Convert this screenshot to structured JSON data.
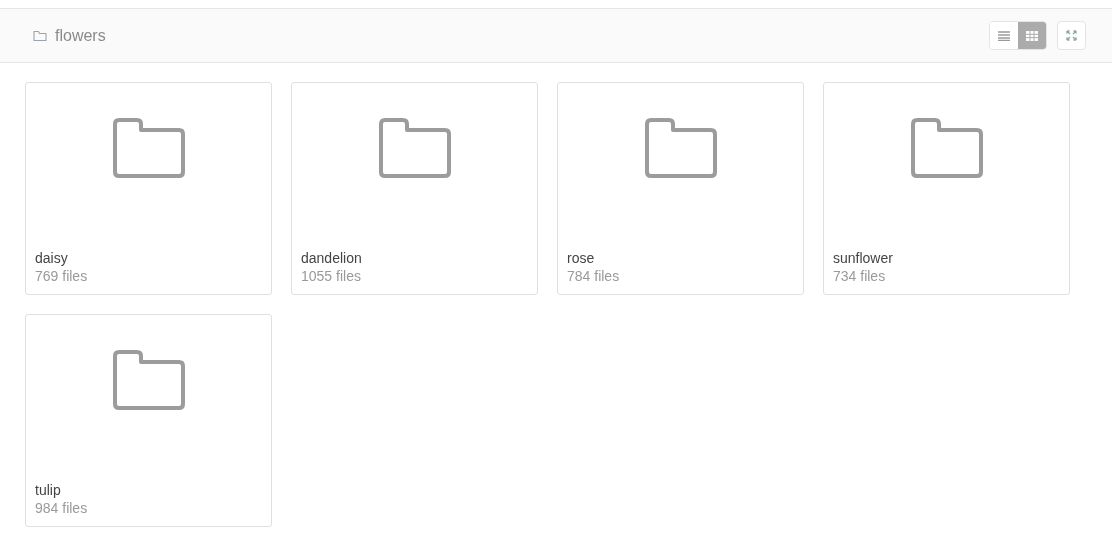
{
  "header": {
    "title": "flowers"
  },
  "view_modes": [
    {
      "kind": "list",
      "selected": false
    },
    {
      "kind": "grid",
      "selected": true
    }
  ],
  "folders": [
    {
      "name": "daisy",
      "count": "769 files"
    },
    {
      "name": "dandelion",
      "count": "1055 files"
    },
    {
      "name": "rose",
      "count": "784 files"
    },
    {
      "name": "sunflower",
      "count": "734 files"
    },
    {
      "name": "tulip",
      "count": "984 files"
    }
  ]
}
